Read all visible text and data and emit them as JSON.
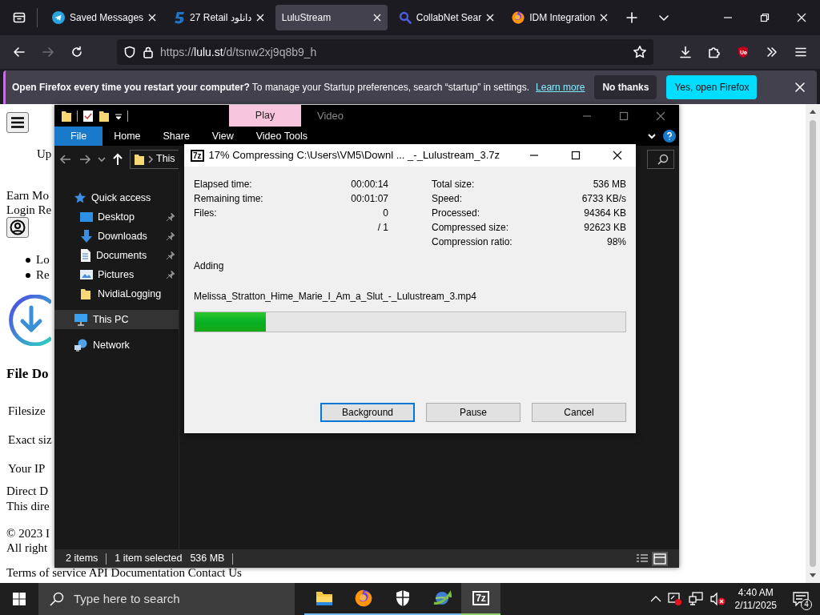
{
  "browser": {
    "tabs": [
      {
        "title": "Saved Messages",
        "kind": "telegram",
        "selected": false
      },
      {
        "title": "27 Retail دانلود",
        "kind": "five",
        "selected": false
      },
      {
        "title": "LuluStream",
        "kind": "none",
        "selected": true
      },
      {
        "title": "CollabNet Sear",
        "kind": "search",
        "selected": false
      },
      {
        "title": "IDM Integration",
        "kind": "firefox",
        "selected": false
      }
    ],
    "url": "https://**lulu.st**/d/tsnw2xj9q8b9_h",
    "notification": {
      "message": "**Open Firefox every time you restart your computer?** To manage your Startup preferences, search “startup” in settings.",
      "link": "Learn more",
      "buttons": [
        {
          "label": "No thanks",
          "kind": "secondary"
        },
        {
          "label": "Yes, open Firefox",
          "kind": "primary"
        }
      ]
    },
    "page": {
      "rows": [
        {
          "kind": "menu-button"
        },
        {
          "kind": "indented-link",
          "text": "Up"
        },
        {
          "kind": "links",
          "texts": [
            "Earn Mo"
          ]
        },
        {
          "kind": "links",
          "texts": [
            "Login",
            "Re"
          ]
        },
        {
          "kind": "user-button"
        },
        {
          "kind": "bullet-link",
          "text": "Lo"
        },
        {
          "kind": "bullet-link",
          "text": "Re"
        },
        {
          "kind": "download-icon"
        },
        {
          "kind": "heading",
          "text": "File Do"
        },
        {
          "kind": "text",
          "text": "Filesize"
        },
        {
          "kind": "text",
          "text": "Exact siz"
        },
        {
          "kind": "text",
          "text": "Your IP"
        },
        {
          "kind": "links",
          "texts": [
            "Direct D"
          ]
        },
        {
          "kind": "plain",
          "text": "This dire"
        },
        {
          "kind": "plain",
          "text": "© 2023 I"
        },
        {
          "kind": "plain",
          "text": "All right"
        },
        {
          "kind": "links",
          "texts": [
            "Terms of service",
            "API Documentation",
            "Contact Us"
          ]
        }
      ]
    }
  },
  "explorer": {
    "context_header": "Play",
    "title": "Video",
    "ribbon_tabs": [
      {
        "label": "File",
        "kind": "file"
      },
      {
        "label": "Home",
        "kind": "tab"
      },
      {
        "label": "Share",
        "kind": "tab"
      },
      {
        "label": "View",
        "kind": "tab"
      },
      {
        "label": "Video Tools",
        "kind": "tab"
      }
    ],
    "address": "This",
    "nav": [
      {
        "label": "Quick access",
        "kind": "star",
        "selected": false,
        "children": [
          {
            "label": "Desktop",
            "kind": "desktop",
            "pinned": true,
            "selected": false
          },
          {
            "label": "Downloads",
            "kind": "downloads",
            "pinned": true,
            "selected": false
          },
          {
            "label": "Documents",
            "kind": "documents",
            "pinned": true,
            "selected": false
          },
          {
            "label": "Pictures",
            "kind": "pictures",
            "pinned": true,
            "selected": false
          },
          {
            "label": "NvidiaLogging",
            "kind": "folder",
            "pinned": false,
            "selected": false
          }
        ]
      },
      {
        "label": "This PC",
        "kind": "pc",
        "selected": true
      },
      {
        "label": "Network",
        "kind": "network",
        "selected": false
      }
    ],
    "status": [
      "2 items",
      "1 item selected",
      "536 MB"
    ]
  },
  "dialog": {
    "logo": "7z",
    "title": "17% Compressing C:\\Users\\VM5\\Downl ... _-_Lulustream_3.7z",
    "left_stats": [
      {
        "label": "Elapsed time:",
        "value": "00:00:14"
      },
      {
        "label": "Remaining time:",
        "value": "00:01:07"
      },
      {
        "label": "Files:",
        "value": "0"
      },
      {
        "value": "/ 1"
      }
    ],
    "right_stats": [
      {
        "label": "Total size:",
        "value": "536 MB"
      },
      {
        "label": "Speed:",
        "value": "6733 KB/s"
      },
      {
        "label": "Processed:",
        "value": "94364 KB"
      },
      {
        "label": "Compressed size:",
        "value": "92623 KB"
      },
      {
        "label": "Compression ratio:",
        "value": "98%"
      }
    ],
    "status": "Adding",
    "file": "Melissa_Stratton_Hime_Marie_I_Am_a_Slut_-_Lulustream_3.mp4",
    "progress": {
      "level": 0.165
    },
    "buttons": [
      {
        "label": "Background",
        "focused": true
      },
      {
        "label": "Pause",
        "focused": false
      },
      {
        "label": "Cancel",
        "focused": false
      }
    ]
  },
  "taskbar": {
    "search_placeholder": "Type here to search",
    "apps": [
      {
        "kind": "explorer",
        "selected": false
      },
      {
        "kind": "firefox",
        "selected": false
      },
      {
        "kind": "security",
        "selected": false
      },
      {
        "kind": "idm",
        "selected": false
      },
      {
        "kind": "sevenzip",
        "label": "7z",
        "selected": true
      }
    ],
    "time": "4:40 AM",
    "date": "2/11/2025",
    "notification_count": "4"
  }
}
